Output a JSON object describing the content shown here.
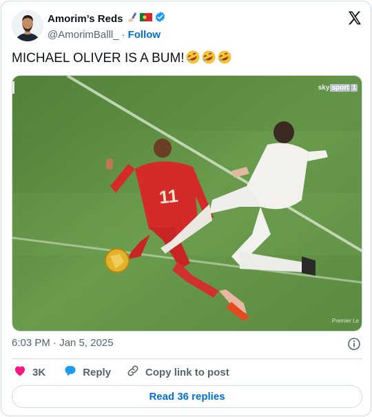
{
  "author": {
    "display_name": "Amorim’s Reds",
    "handle": "@AmorimBalll_",
    "follow_label": "Follow",
    "separator": "·",
    "badges": [
      "writing-hand-emoji",
      "portugal-flag-emoji",
      "verified-badge-icon"
    ]
  },
  "tweet": {
    "text": "MICHAEL OLIVER IS A BUM!",
    "emoji": [
      "rolling-on-floor-laughing-emoji",
      "rolling-on-floor-laughing-emoji",
      "rolling-on-floor-laughing-emoji"
    ],
    "media": {
      "broadcaster_logo": "sky",
      "broadcaster_sub": "sport",
      "channel_number": "1",
      "watermark": "Premier Le",
      "player_number": "11"
    }
  },
  "meta": {
    "timestamp": "6:03 PM · Jan 5, 2025"
  },
  "actions": {
    "like_count": "3K",
    "reply_label": "Reply",
    "copy_label": "Copy link to post"
  },
  "footer": {
    "read_replies_label": "Read 36 replies"
  },
  "colors": {
    "accent": "#006fd6",
    "like": "#f91880",
    "reply": "#1d9bf0",
    "verified": "#1d9bf0",
    "pitch": "#5f8f45",
    "liverpool_red": "#d52a2a"
  }
}
